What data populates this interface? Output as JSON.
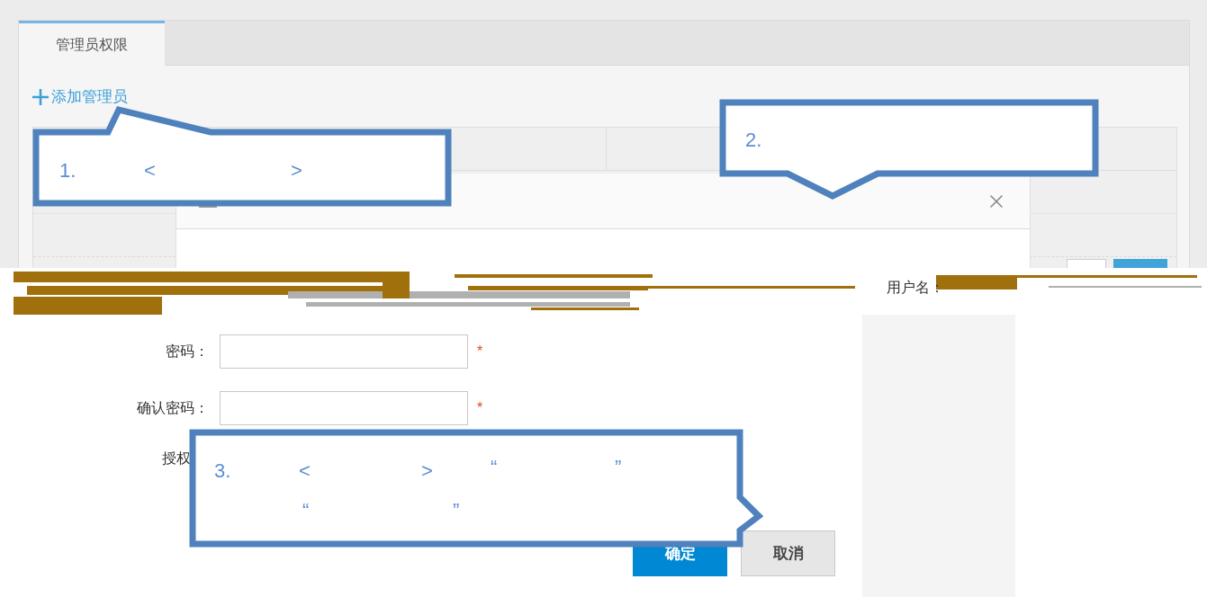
{
  "tabs": [
    {
      "label": "管理员权限",
      "selected": true
    }
  ],
  "add_link": {
    "label": "添加管理员"
  },
  "username_label": "用户名：",
  "form": {
    "fields": [
      {
        "label": "密码：",
        "required_mark": "*"
      },
      {
        "label": "确认密码：",
        "required_mark": "*"
      }
    ],
    "authorize_label": "授权"
  },
  "buttons": [
    {
      "label": "确定",
      "kind": "primary"
    },
    {
      "label": "取消",
      "kind": "secondary"
    }
  ],
  "callouts": [
    {
      "marks": [
        "1.",
        "<",
        ">"
      ]
    },
    {
      "marks": [
        "2."
      ]
    },
    {
      "marks": [
        "3.",
        "<",
        ">",
        "“",
        "”",
        "“",
        "”"
      ]
    }
  ]
}
